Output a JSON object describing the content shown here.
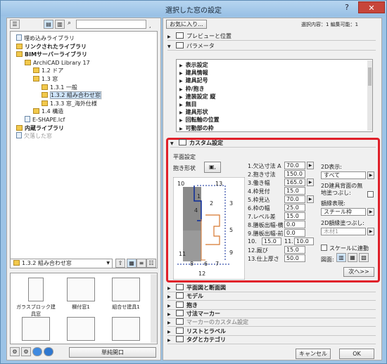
{
  "window": {
    "title": "選択した窓の設定",
    "help": "?",
    "close": "✕"
  },
  "left": {
    "tree": [
      {
        "label": "埋め込みライブラリ",
        "icon": "file",
        "bold": false
      },
      {
        "label": "リンクされたライブラリ",
        "icon": "folder",
        "bold": true
      },
      {
        "label": "BIMサーバーライブラリ",
        "icon": "folder",
        "bold": true
      },
      {
        "label": "ArchiCAD Library 17",
        "icon": "folder",
        "bold": false
      },
      {
        "label": "1.2 ドア",
        "icon": "folder",
        "bold": false
      },
      {
        "label": "1.3 窓",
        "icon": "folder",
        "bold": false
      },
      {
        "label": "1.3.1 一般",
        "icon": "folder",
        "bold": false
      },
      {
        "label": "1.3.2 組み合わせ窓",
        "icon": "folder",
        "bold": false,
        "selected": true
      },
      {
        "label": "1.3.3 窓_海外仕様",
        "icon": "folder",
        "bold": false
      },
      {
        "label": "1.4 構造",
        "icon": "folder",
        "bold": false
      },
      {
        "label": "E-SHAPE.lcf",
        "icon": "file",
        "bold": false
      },
      {
        "label": "内蔵ライブラリ",
        "icon": "folder",
        "bold": true
      },
      {
        "label": "欠落した窓",
        "icon": "file",
        "bold": false,
        "gray": true
      }
    ],
    "path": "1.3.2 組み合わせ窓",
    "thumbs": [
      {
        "label": "ガラスブロック建具窓"
      },
      {
        "label": "欄付窓1"
      },
      {
        "label": "組合せ建具1"
      },
      {
        "label": ""
      },
      {
        "label": ""
      },
      {
        "label": ""
      }
    ],
    "simple_button": "単純開口"
  },
  "right": {
    "favorites_button": "お気に入り...",
    "status": "選択内容：1 編集可能：1",
    "section_preview": "プレビューと位置",
    "section_params": "パラメータ",
    "params": [
      "表示設定",
      "建具情報",
      "建具記号",
      "枠/抱き",
      "連装設定 縦",
      "無目",
      "建具形状",
      "回転軸の位置",
      "可動部の枠"
    ],
    "custom_title": "カスタム設定",
    "plan_settings": "平面設定",
    "reveal_shape": "抱き形状",
    "fields": [
      {
        "label": "1.欠込寸法 A",
        "value": "70.0",
        "spin": true
      },
      {
        "label": "2.抱き寸法",
        "value": "150.0"
      },
      {
        "label": "3.働き幅",
        "value": "165.0",
        "spin": true
      },
      {
        "label": "4.枠見付",
        "value": "15.0"
      },
      {
        "label": "5.枠見込",
        "value": "70.0",
        "spin": true
      },
      {
        "label": "6.枠の幅",
        "value": "25.0"
      },
      {
        "label": "7.レベル差",
        "value": "15.0"
      },
      {
        "label": "8.膳板出幅-横",
        "value": "0.0"
      },
      {
        "label": "9.膳板出幅-前",
        "value": "0.0"
      },
      {
        "label": "10.",
        "value": "15.0",
        "extra_label": "11.",
        "extra_value": "10.0"
      },
      {
        "label": "12.厩び",
        "value": "15.0"
      },
      {
        "label": "13.仕上厚さ",
        "value": "50.0"
      }
    ],
    "display_2d_label": "2D表示:",
    "display_2d_value": "すべて",
    "no_back_label": "2D建具背面の無地塗つぶし:",
    "outline_label": "額縁表現:",
    "outline_value": "スチール枠",
    "fill_label": "2D額縁塗つぶし:",
    "fill_value": "木材1",
    "scale_label": "スケールに連動",
    "symbol_label": "図面:",
    "next_button": "次へ>>",
    "diagram_labels": [
      "10",
      "1",
      "13",
      "4",
      "2",
      "3",
      "5",
      "9",
      "11",
      "8",
      "6",
      "7",
      "12"
    ],
    "sections_after": [
      {
        "label": "平面図と断面図",
        "disabled": false
      },
      {
        "label": "モデル",
        "disabled": false
      },
      {
        "label": "抱き",
        "disabled": false
      },
      {
        "label": "寸法マーカー",
        "disabled": false
      },
      {
        "label": "マーカーのカスタム設定",
        "disabled": true
      },
      {
        "label": "リストとラベル",
        "disabled": false
      },
      {
        "label": "タグとカテゴリ",
        "disabled": false
      }
    ],
    "cancel_button": "キャンセル",
    "ok_button": "OK"
  },
  "colors": {
    "highlight": "#e0202a",
    "accent": "#f2c94c",
    "titlebar": "#9cc3e6"
  }
}
